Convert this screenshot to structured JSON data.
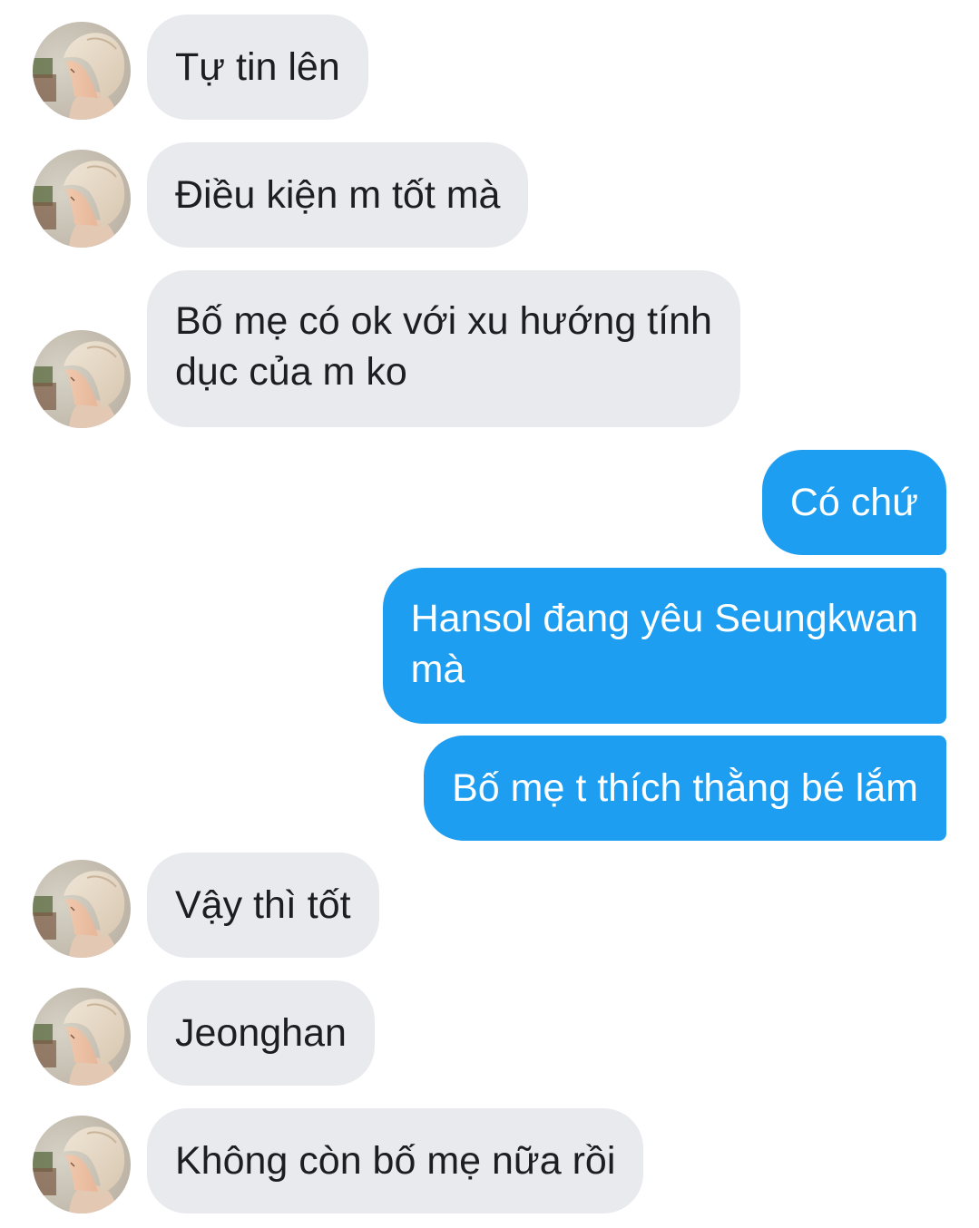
{
  "conversation": {
    "messages": [
      {
        "side": "in",
        "text": "Tự tin lên"
      },
      {
        "side": "in",
        "text": "Điều kiện m tốt mà"
      },
      {
        "side": "in",
        "text": "Bố mẹ có ok với xu hướng tính dục của m ko",
        "line1": "Bố mẹ có ok với xu hướng tính",
        "line2": "dục của m ko"
      },
      {
        "side": "out",
        "text": "Có chứ"
      },
      {
        "side": "out",
        "text": "Hansol đang yêu Seungkwan mà",
        "line1": "Hansol đang yêu Seungkwan",
        "line2": "mà"
      },
      {
        "side": "out",
        "text": "Bố mẹ t thích thằng bé lắm"
      },
      {
        "side": "in",
        "text": "Vậy thì tốt"
      },
      {
        "side": "in",
        "text": "Jeonghan"
      },
      {
        "side": "in",
        "text": "Không còn bố mẹ nữa rồi"
      }
    ]
  },
  "colors": {
    "incoming_bubble": "#e9eaee",
    "outgoing_bubble": "#1e9ef0",
    "incoming_text": "#1c1e21",
    "outgoing_text": "#ffffff"
  },
  "icons": {
    "avatar": "contact-avatar-photo"
  }
}
